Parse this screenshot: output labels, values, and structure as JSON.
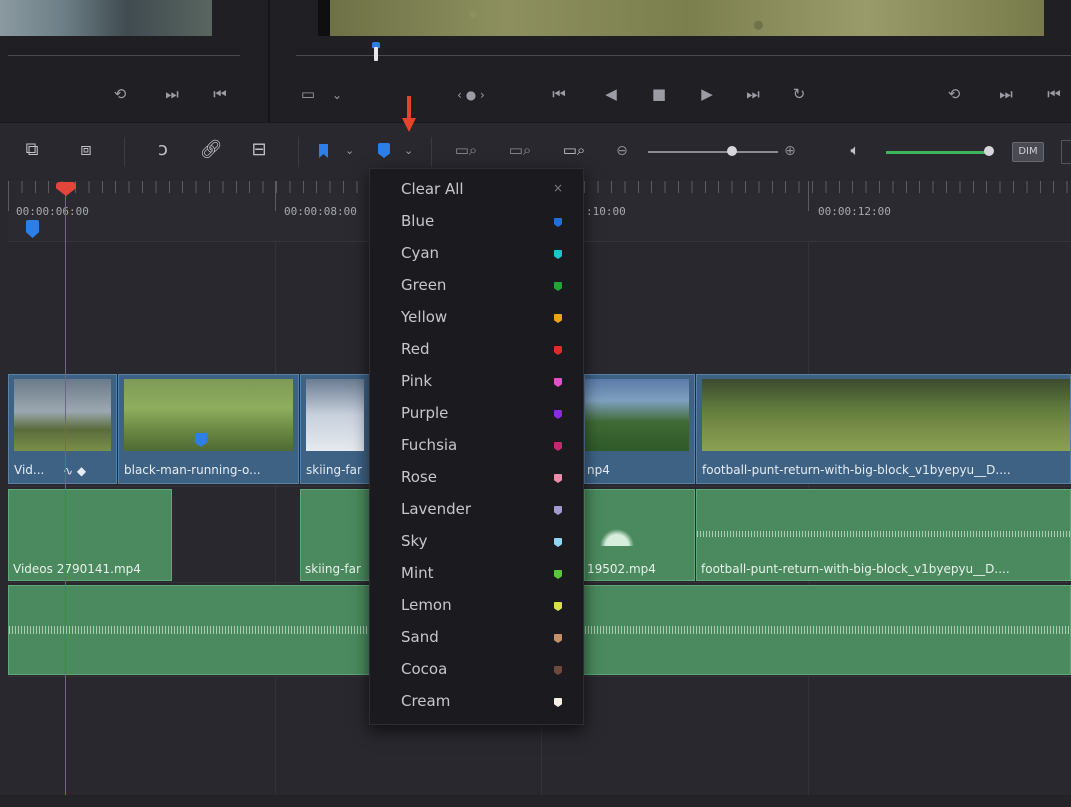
{
  "timeline": {
    "timecodes": [
      "00:00:06:00",
      "00:00:08:00",
      ":10:00",
      "00:00:12:00"
    ]
  },
  "toolbar": {
    "dim_label": "DIM"
  },
  "video_clips": [
    {
      "label": "Vid..."
    },
    {
      "label": "black-man-running-o..."
    },
    {
      "label": "skiing-far"
    },
    {
      "label": "np4"
    },
    {
      "label": "football-punt-return-with-big-block_v1byepyu__D...."
    }
  ],
  "audio_clips": [
    {
      "label": "Videos 2790141.mp4"
    },
    {
      "label": "skiing-far"
    },
    {
      "label": "19502.mp4"
    },
    {
      "label": "football-punt-return-with-big-block_v1byepyu__D...."
    }
  ],
  "marker_menu": {
    "clear_all": "Clear All",
    "close_glyph": "×",
    "colors": [
      {
        "name": "Blue",
        "hex": "#1e6fe0"
      },
      {
        "name": "Cyan",
        "hex": "#17c7c9"
      },
      {
        "name": "Green",
        "hex": "#1fa637"
      },
      {
        "name": "Yellow",
        "hex": "#f0a319"
      },
      {
        "name": "Red",
        "hex": "#e02b2b"
      },
      {
        "name": "Pink",
        "hex": "#e84fc6"
      },
      {
        "name": "Purple",
        "hex": "#8a2be2"
      },
      {
        "name": "Fuchsia",
        "hex": "#c4286f"
      },
      {
        "name": "Rose",
        "hex": "#f08aa8"
      },
      {
        "name": "Lavender",
        "hex": "#a39ad0"
      },
      {
        "name": "Sky",
        "hex": "#8fd6f0"
      },
      {
        "name": "Mint",
        "hex": "#55c936"
      },
      {
        "name": "Lemon",
        "hex": "#d8e04a"
      },
      {
        "name": "Sand",
        "hex": "#c2916a"
      },
      {
        "name": "Cocoa",
        "hex": "#6e4a3e"
      },
      {
        "name": "Cream",
        "hex": "#f4f0e4"
      }
    ]
  }
}
